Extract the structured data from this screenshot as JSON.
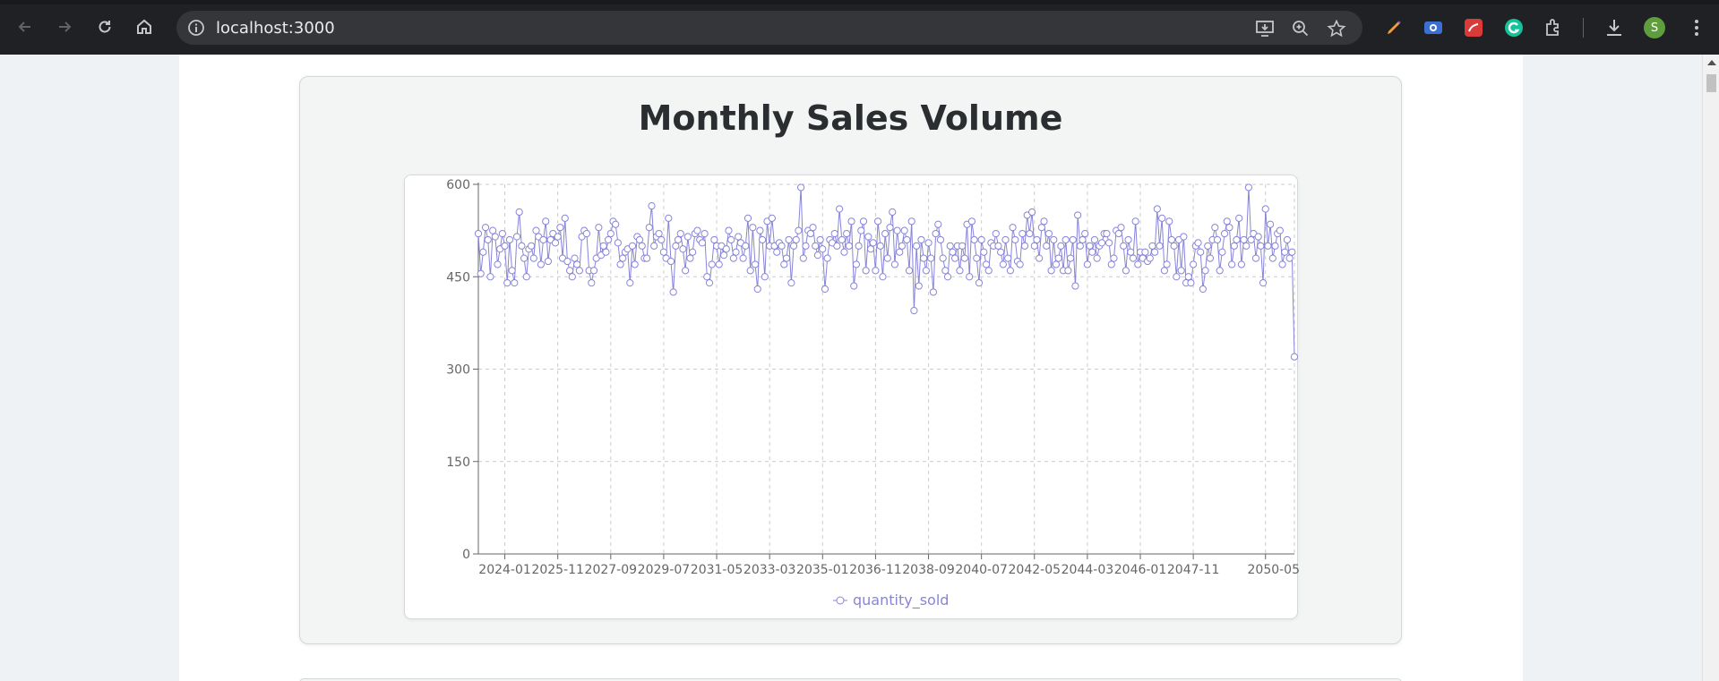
{
  "browser": {
    "url": "localhost:3000",
    "avatar_letter": "S"
  },
  "card": {
    "title": "Monthly Sales Volume"
  },
  "colors": {
    "series": "#8884d8",
    "grid": "#cccccc",
    "axis": "#666666"
  },
  "chart_data": {
    "type": "line",
    "title": "Monthly Sales Volume",
    "xlabel": "",
    "ylabel": "",
    "ylim": [
      0,
      600
    ],
    "yticks": [
      0,
      150,
      300,
      450,
      600
    ],
    "grid": true,
    "legend_position": "bottom",
    "x_start": "2023-02",
    "x_tick_labels": [
      "2024-01",
      "2025-11",
      "2027-09",
      "2029-07",
      "2031-05",
      "2033-03",
      "2035-01",
      "2036-11",
      "2038-09",
      "2040-07",
      "2042-05",
      "2044-03",
      "2046-01",
      "2047-11",
      "2050-05"
    ],
    "series": [
      {
        "name": "quantity_sold",
        "values": [
          520,
          455,
          490,
          530,
          510,
          450,
          525,
          515,
          470,
          495,
          520,
          500,
          440,
          510,
          460,
          440,
          515,
          555,
          500,
          480,
          450,
          495,
          500,
          480,
          525,
          515,
          470,
          510,
          540,
          475,
          510,
          520,
          505,
          515,
          530,
          480,
          545,
          475,
          460,
          450,
          480,
          470,
          460,
          515,
          525,
          520,
          460,
          440,
          460,
          480,
          530,
          485,
          500,
          490,
          510,
          520,
          540,
          535,
          505,
          470,
          480,
          490,
          495,
          440,
          500,
          470,
          515,
          510,
          500,
          480,
          480,
          530,
          565,
          500,
          515,
          520,
          510,
          490,
          480,
          545,
          475,
          425,
          500,
          510,
          520,
          495,
          460,
          515,
          480,
          490,
          520,
          525,
          510,
          505,
          520,
          450,
          440,
          470,
          510,
          500,
          470,
          500,
          485,
          495,
          525,
          510,
          480,
          490,
          515,
          505,
          480,
          500,
          545,
          460,
          530,
          470,
          430,
          525,
          510,
          450,
          540,
          500,
          545,
          500,
          490,
          505,
          500,
          470,
          480,
          510,
          440,
          500,
          510,
          525,
          595,
          480,
          500,
          525,
          520,
          530,
          500,
          485,
          510,
          495,
          430,
          480,
          510,
          505,
          520,
          500,
          560,
          510,
          490,
          520,
          500,
          540,
          435,
          470,
          500,
          525,
          540,
          460,
          515,
          495,
          505,
          460,
          540,
          500,
          450,
          520,
          480,
          530,
          555,
          470,
          525,
          490,
          500,
          525,
          510,
          460,
          540,
          395,
          500,
          435,
          510,
          480,
          460,
          505,
          480,
          425,
          520,
          535,
          510,
          480,
          460,
          450,
          500,
          490,
          480,
          500,
          460,
          500,
          480,
          535,
          450,
          540,
          510,
          480,
          440,
          510,
          490,
          470,
          460,
          505,
          500,
          520,
          500,
          490,
          470,
          510,
          480,
          460,
          530,
          510,
          475,
          470,
          520,
          500,
          550,
          520,
          555,
          500,
          510,
          480,
          530,
          540,
          500,
          520,
          460,
          510,
          470,
          480,
          500,
          460,
          510,
          460,
          480,
          510,
          435,
          550,
          500,
          510,
          520,
          470,
          500,
          490,
          510,
          480,
          500,
          505,
          520,
          520,
          505,
          470,
          480,
          525,
          520,
          530,
          500,
          460,
          510,
          490,
          480,
          540,
          470,
          490,
          480,
          490,
          475,
          480,
          500,
          490,
          560,
          500,
          545,
          460,
          470,
          540,
          510,
          500,
          450,
          510,
          460,
          515,
          440,
          450,
          440,
          470,
          500,
          505,
          490,
          430,
          460,
          500,
          480,
          510,
          530,
          510,
          460,
          490,
          520,
          540,
          530,
          470,
          500,
          510,
          545,
          470,
          510,
          500,
          595,
          510,
          520,
          480,
          515,
          500,
          440,
          560,
          500,
          535,
          480,
          500,
          520,
          525,
          470,
          490,
          510,
          480,
          490,
          320
        ]
      }
    ]
  }
}
